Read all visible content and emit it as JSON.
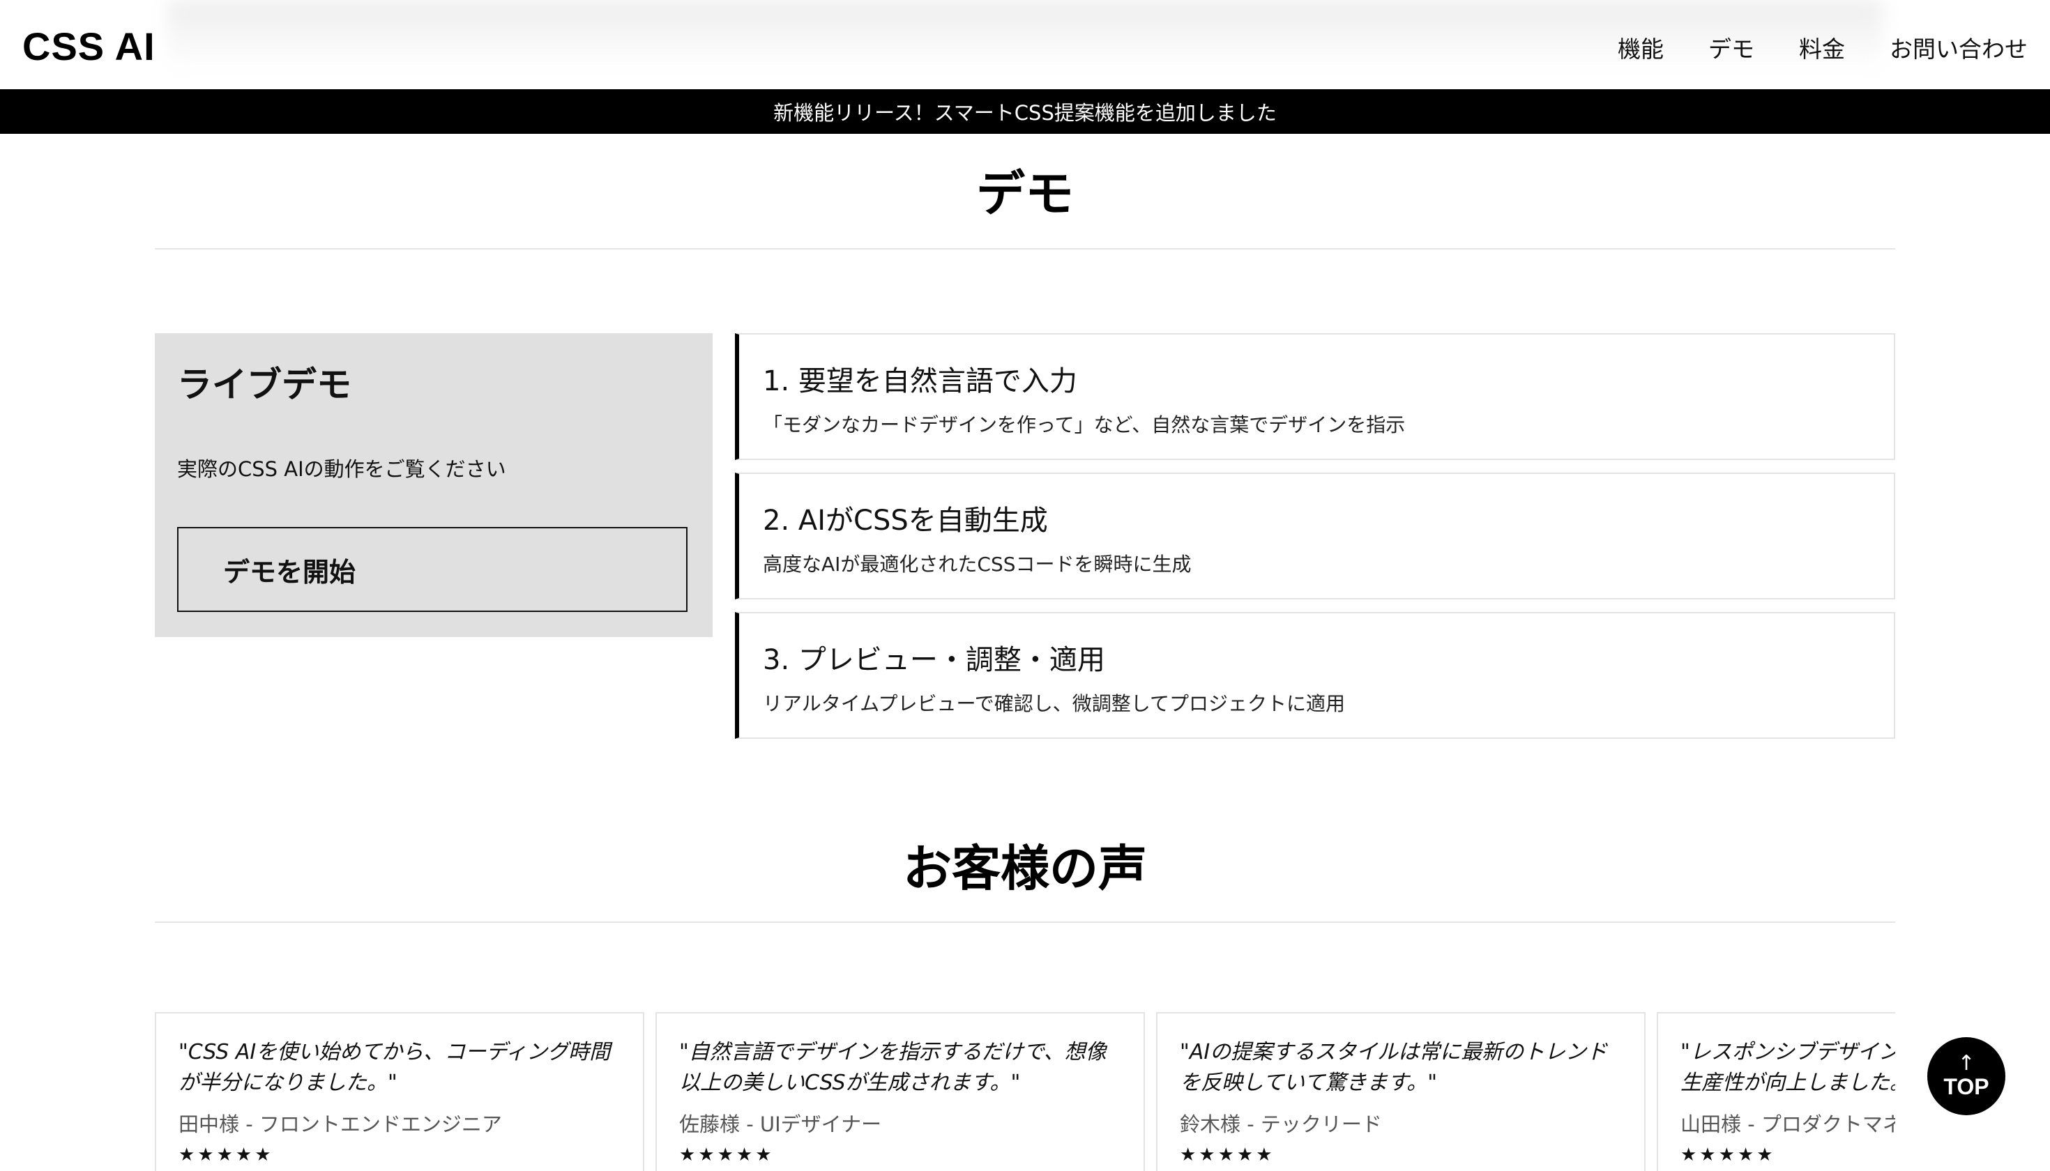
{
  "header": {
    "logo": "CSS AI",
    "nav": [
      "機能",
      "デモ",
      "料金",
      "お問い合わせ"
    ]
  },
  "announcement": "新機能リリース！スマートCSS提案機能を追加しました",
  "demo_section": {
    "title": "デモ",
    "live": {
      "title": "ライブデモ",
      "description": "実際のCSS AIの動作をご覧ください",
      "button": "デモを開始"
    },
    "steps": [
      {
        "title": "1. 要望を自然言語で入力",
        "description": "「モダンなカードデザインを作って」など、自然な言葉でデザインを指示"
      },
      {
        "title": "2. AIがCSSを自動生成",
        "description": "高度なAIが最適化されたCSSコードを瞬時に生成"
      },
      {
        "title": "3. プレビュー・調整・適用",
        "description": "リアルタイムプレビューで確認し、微調整してプロジェクトに適用"
      }
    ]
  },
  "testimonials_section": {
    "title": "お客様の声",
    "items": [
      {
        "quote": "\"CSS AIを使い始めてから、コーディング時間が半分になりました。\"",
        "author": "田中様 - フロントエンドエンジニア",
        "stars": "★★★★★"
      },
      {
        "quote": "\"自然言語でデザインを指示するだけで、想像以上の美しいCSSが生成されます。\"",
        "author": "佐藤様 - UIデザイナー",
        "stars": "★★★★★"
      },
      {
        "quote": "\"AIの提案するスタイルは常に最新のトレンドを反映していて驚きます。\"",
        "author": "鈴木様 - テックリード",
        "stars": "★★★★★"
      },
      {
        "quote": "\"レスポンシブデザインの作成が簡単になり、生産性が向上しました。\"",
        "author": "山田様 - プロダクトマネージャー",
        "stars": "★★★★★"
      }
    ]
  },
  "top_button": {
    "arrow": "↑",
    "label": "TOP"
  }
}
